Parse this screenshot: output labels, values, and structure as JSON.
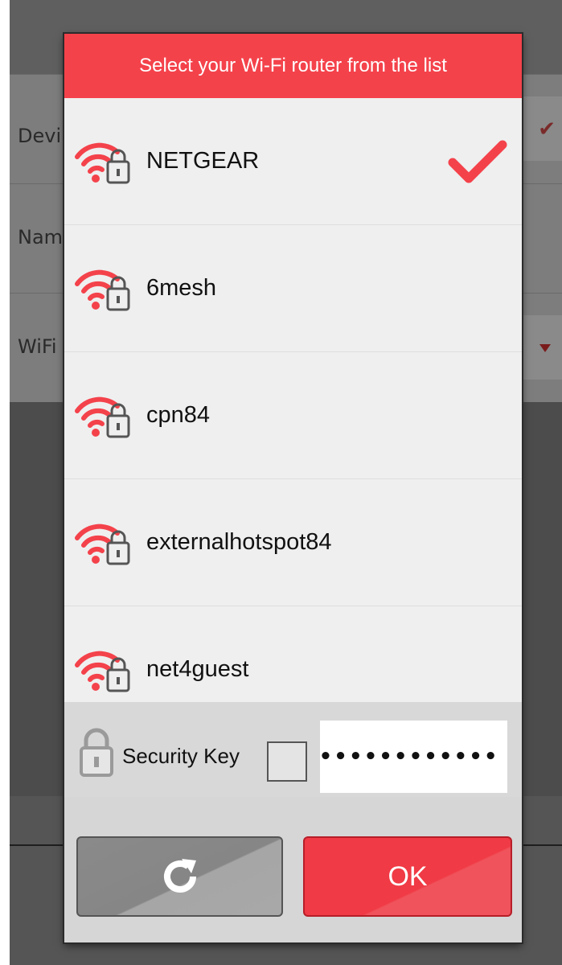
{
  "background": {
    "rows": [
      "Devi",
      "Nam",
      "WiFi"
    ]
  },
  "dialog": {
    "title": "Select your Wi-Fi router from the list",
    "networks": [
      {
        "name": "NETGEAR",
        "selected": true,
        "icon": "wifi-locked-icon"
      },
      {
        "name": "6mesh",
        "selected": false,
        "icon": "wifi-locked-icon"
      },
      {
        "name": "cpn84",
        "selected": false,
        "icon": "wifi-locked-icon"
      },
      {
        "name": "externalhotspot84",
        "selected": false,
        "icon": "wifi-locked-icon"
      },
      {
        "name": "net4guest",
        "selected": false,
        "icon": "wifi-locked-icon"
      }
    ],
    "security_key": {
      "label": "Security Key",
      "show_password_checked": false,
      "value": "••••••••••••"
    },
    "buttons": {
      "refresh_icon": "refresh-icon",
      "ok_label": "OK"
    }
  },
  "colors": {
    "accent": "#f4424b",
    "button_ok": "#f03a45"
  }
}
